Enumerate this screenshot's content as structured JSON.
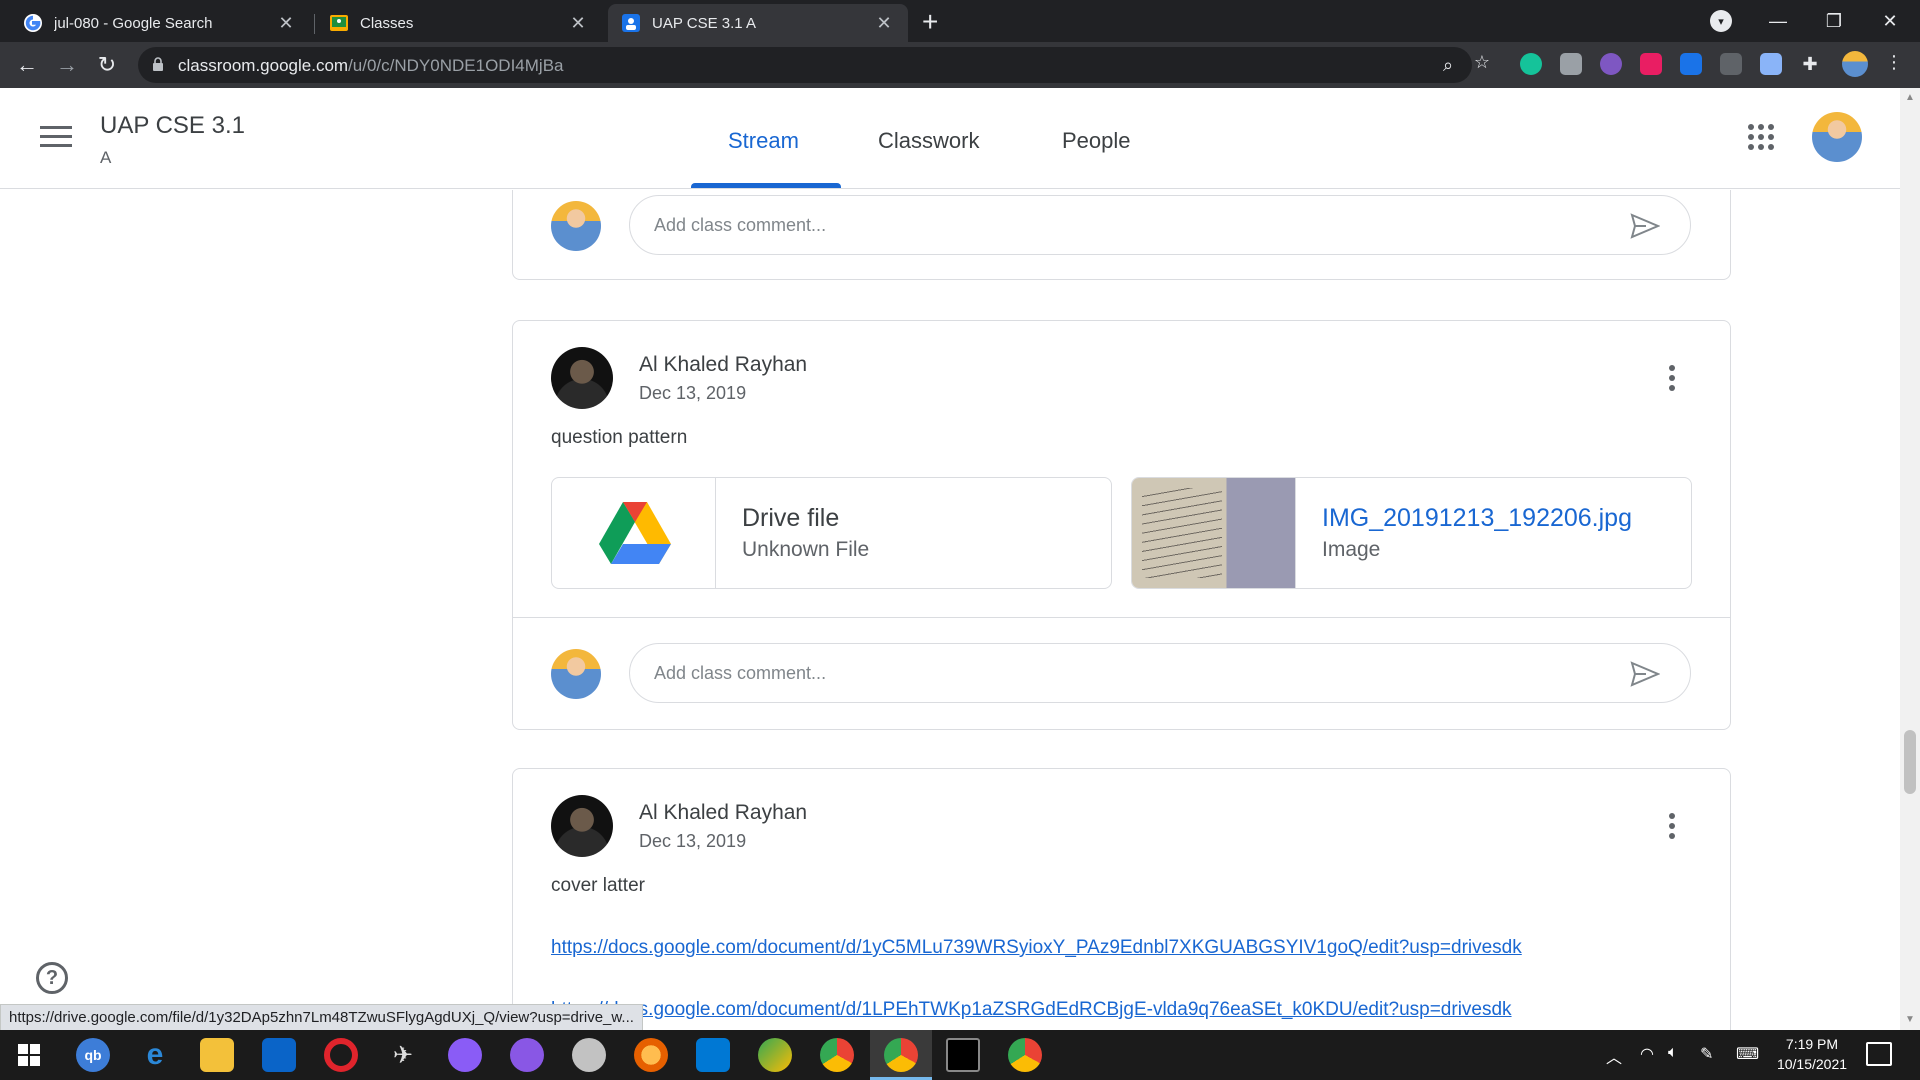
{
  "browser": {
    "tabs": [
      {
        "title": "jul-080 - Google Search",
        "close": "✕"
      },
      {
        "title": "Classes",
        "close": "✕"
      },
      {
        "title": "UAP CSE 3.1 A",
        "close": "✕"
      }
    ],
    "new_tab": "+",
    "url_host": "classroom.google.com",
    "url_path": "/u/0/c/NDY0NDE1ODI4MjBa",
    "status_url": "https://drive.google.com/file/d/1y32DAp5zhn7Lm48TZwuSFlygAgdUXj_Q/view?usp=drive_w..."
  },
  "classroom": {
    "class_title": "UAP CSE 3.1",
    "class_section": "A",
    "nav_tabs": [
      "Stream",
      "Classwork",
      "People"
    ],
    "comment_placeholder": "Add class comment..."
  },
  "posts": [
    {
      "author": "Al Khaled Rayhan",
      "date": "Dec 13, 2019",
      "text": "question pattern",
      "attachments": [
        {
          "title": "Drive file",
          "subtitle": "Unknown File",
          "icon": "google-drive-icon"
        },
        {
          "title": "IMG_20191213_192206.jpg",
          "subtitle": "Image",
          "icon": "image-thumbnail"
        }
      ]
    },
    {
      "author": "Al Khaled Rayhan",
      "date": "Dec 13, 2019",
      "text": "cover latter",
      "links": [
        "https://docs.google.com/document/d/1yC5MLu739WRSyioxY_PAz9Ednbl7XKGUABGSYIV1goQ/edit?usp=drivesdk",
        "https://docs.google.com/document/d/1LPEhTWKp1aZSRGdEdRCBjgE-vlda9q76eaSEt_k0KDU/edit?usp=drivesdk"
      ]
    }
  ],
  "taskbar": {
    "time": "7:19 PM",
    "date": "10/15/2021",
    "qb_label": "qb"
  },
  "colors": {
    "accent": "#1967d2",
    "chrome_dark": "#202124",
    "chrome_toolbar": "#35363a",
    "taskbar": "#1b1b1b"
  }
}
